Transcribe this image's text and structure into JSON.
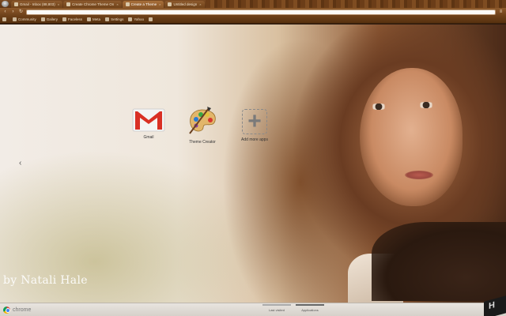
{
  "tabs": [
    {
      "label": "Gmail - Inbox (88,803)",
      "active": false
    },
    {
      "label": "Create Chrome Theme On",
      "active": false
    },
    {
      "label": "Create a Theme",
      "active": true
    },
    {
      "label": "Untitled design",
      "active": false
    }
  ],
  "bookmarks": [
    {
      "label": ""
    },
    {
      "label": "Community"
    },
    {
      "label": "Gallery"
    },
    {
      "label": "Faceless"
    },
    {
      "label": "Meta"
    },
    {
      "label": "Settings"
    },
    {
      "label": "Yahoo"
    },
    {
      "label": ""
    }
  ],
  "toolbar": {
    "omnibox_value": ""
  },
  "apps": [
    {
      "label": "Gmail",
      "icon": "gmail-icon"
    },
    {
      "label": "Theme Creator",
      "icon": "palette-icon"
    },
    {
      "label": "Add more apps",
      "icon": "add-icon"
    }
  ],
  "signature": "by Natali Hale",
  "bottombar": {
    "brand": "chrome",
    "pages": [
      "Last visited",
      "Applications"
    ]
  }
}
